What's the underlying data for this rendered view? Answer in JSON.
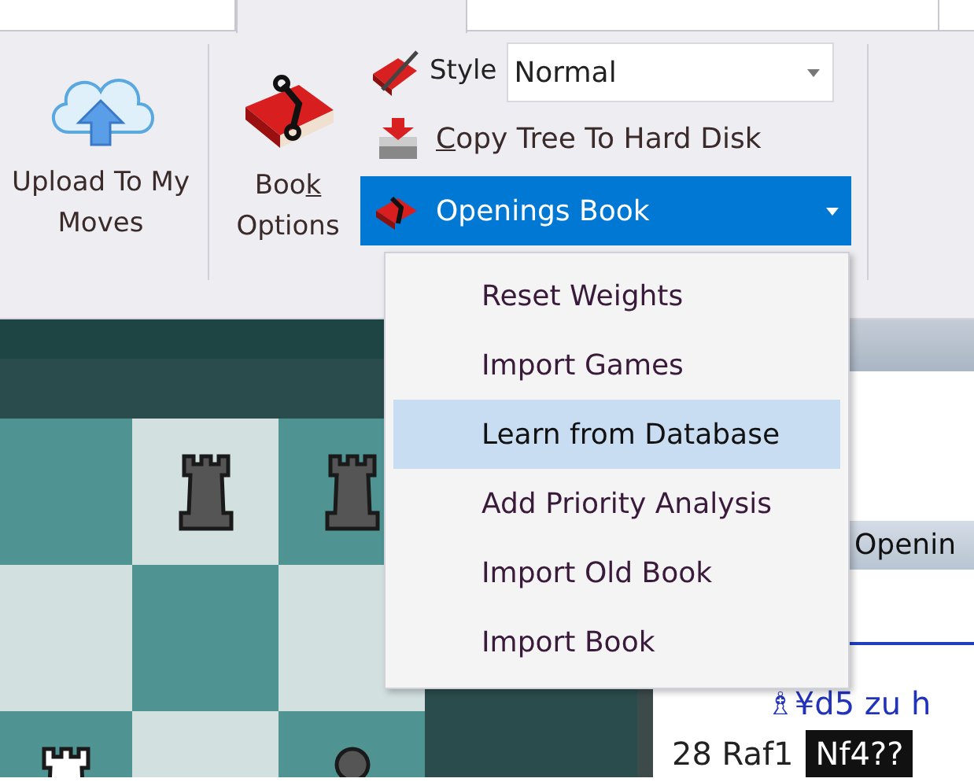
{
  "tabs": [
    {
      "selected": false
    },
    {
      "selected": true
    },
    {
      "selected": false
    }
  ],
  "ribbon": {
    "upload_button": {
      "label": "Upload To My Moves"
    },
    "book_options_button": {
      "label_parts": [
        {
          "text": "Boo",
          "underlined": false
        },
        {
          "text": "k",
          "underlined": true
        },
        {
          "text": " Options",
          "underlined": false
        }
      ]
    },
    "style_field": {
      "label": "Style",
      "value": "Normal"
    },
    "copy_button": {
      "label_parts": [
        {
          "text": "C",
          "underlined": true
        },
        {
          "text": "opy Tree To Hard Disk",
          "underlined": false
        }
      ]
    },
    "openings_book_button": {
      "label": "Openings Book",
      "expanded": true
    }
  },
  "openings_book_menu": [
    {
      "label": "Reset Weights",
      "selected": false
    },
    {
      "label": "Import Games",
      "selected": false
    },
    {
      "label": "Learn from Database",
      "selected": true
    },
    {
      "label": "Add Priority Analysis",
      "selected": false
    },
    {
      "label": "Import Old Book",
      "selected": false
    },
    {
      "label": "Import Book",
      "selected": false
    }
  ],
  "board": {
    "rows": [
      [
        {
          "kind": "empty"
        },
        {
          "kind": "black_rook"
        },
        {
          "kind": "black_rook"
        }
      ],
      [
        {
          "kind": "empty"
        },
        {
          "kind": "empty"
        },
        {
          "kind": "empty"
        }
      ],
      [
        {
          "kind": "white_rook"
        },
        {
          "kind": "empty"
        },
        {
          "kind": "black_pawn"
        }
      ]
    ]
  },
  "notation_panel": {
    "column_header": "Openin",
    "comment": "♗¥d5 zu h",
    "move_number": "28 Raf1",
    "current_move": "Nf4??"
  }
}
